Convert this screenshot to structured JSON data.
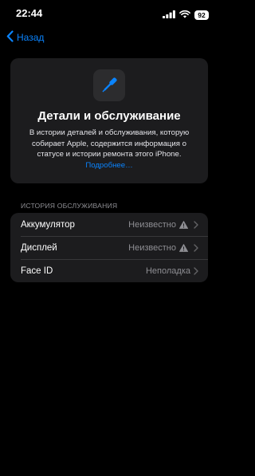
{
  "status_bar": {
    "time": "22:44",
    "battery": "92",
    "icons": [
      "signal-icon",
      "wifi-icon",
      "battery-icon"
    ]
  },
  "nav": {
    "back_label": "Назад",
    "back_icon": "chevron-left-icon"
  },
  "info_card": {
    "icon": "screwdriver-icon",
    "title": "Детали и обслуживание",
    "description": "В истории деталей и обслуживания, которую собирает Apple, содержится информация о статусе и истории ремонта этого iPhone.",
    "link": "Подробнее…"
  },
  "service_history": {
    "header": "ИСТОРИЯ ОБСЛУЖИВАНИЯ",
    "rows": [
      {
        "label": "Аккумулятор",
        "value": "Неизвестно",
        "warning": true
      },
      {
        "label": "Дисплей",
        "value": "Неизвестно",
        "warning": true
      },
      {
        "label": "Face ID",
        "value": "Неполадка",
        "warning": false
      }
    ]
  },
  "colors": {
    "accent": "#0a84ff",
    "background": "#000000",
    "card": "#1c1c1e",
    "secondary_text": "#8e8e93"
  }
}
